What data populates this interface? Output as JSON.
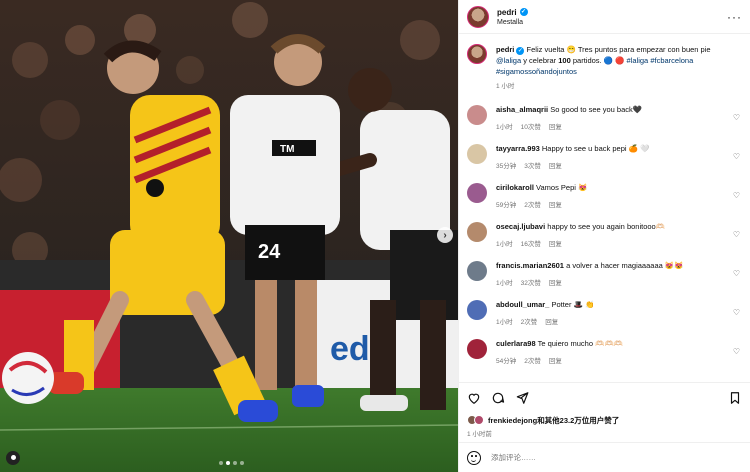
{
  "post": {
    "username": "pedri",
    "location": "Mestalla",
    "caption_text": "Feliz vuelta 😁 Tres puntos para empezar con buen pie @laliga y celebrar 🅒🅒🅒 partidos. 🔵 🔴 #laliga #fcbarcelona #sigamossoñandojuntos",
    "caption_user": "pedri",
    "caption_main": "Feliz vuelta 😁 Tres puntos para empezar con buen pie ",
    "caption_mention": "@laliga",
    "caption_mid": " y celebrar ",
    "caption_badge": "100",
    "caption_mid2": " partidos. 🔵 🔴 ",
    "caption_tags": "#laliga #fcbarcelona #sigamossoñandojuntos",
    "caption_time": "1 小时",
    "likes_user": "frenkiedejong",
    "likes_rest": "和其他23.2万位用户赞了",
    "post_time": "1 小时前",
    "add_comment_placeholder": "添加评论……",
    "more_icon": "···"
  },
  "comments": [
    {
      "user": "aisha_almaqrii",
      "text": "So good to see you back🖤",
      "time": "1小时",
      "likes": "10次赞",
      "reply": "回复",
      "color": "#c98c8c"
    },
    {
      "user": "tayyarra.993",
      "text": "Happy to see u back pepi 🍊 🤍",
      "time": "35分钟",
      "likes": "3次赞",
      "reply": "回复",
      "color": "#d9c6a5"
    },
    {
      "user": "cirilokaroll",
      "text": "Vamos Pepi 😻",
      "time": "59分钟",
      "likes": "2次赞",
      "reply": "回复",
      "color": "#9a5b8f"
    },
    {
      "user": "osecaj.ljubavi",
      "text": "happy to see you again bonitooo🫶🏻",
      "time": "1小时",
      "likes": "16次赞",
      "reply": "回复",
      "color": "#b48a6c"
    },
    {
      "user": "francis.marian2601",
      "text": "a volver a hacer magiaaaaaa 😻😻",
      "time": "1小时",
      "likes": "32次赞",
      "reply": "回复",
      "color": "#6e7b8a"
    },
    {
      "user": "abdoull_umar_",
      "text": "Potter 🎩 👏",
      "time": "1小时",
      "likes": "2次赞",
      "reply": "回复",
      "color": "#4f6db5"
    },
    {
      "user": "culerlara98",
      "text": "Te quiero mucho 🫶🏻🫶🏻🫶🏻",
      "time": "54分钟",
      "likes": "2次赞",
      "reply": "回复",
      "color": "#a0233a"
    }
  ],
  "icons": {
    "like": "heart-icon",
    "comment": "comment-icon",
    "share": "send-icon",
    "save": "bookmark-icon",
    "emoji": "emoji-icon",
    "verified": "verified-badge-icon",
    "next": "chevron-right-icon",
    "tag": "user-tag-icon"
  },
  "carousel": {
    "count": 4,
    "active": 1
  },
  "colors": {
    "link": "#00376b",
    "verified": "#0095f6",
    "muted": "#737373",
    "barca_yellow": "#f5c518",
    "valencia_white": "#f2f2f2"
  }
}
